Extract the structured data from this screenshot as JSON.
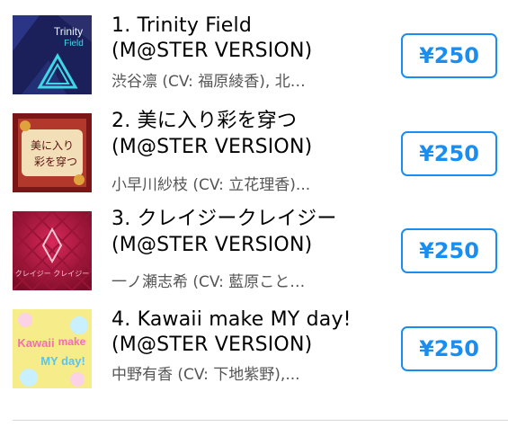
{
  "tracks": [
    {
      "title_line1": "1. Trinity Field",
      "title_line2": "(M@STER VERSION)",
      "artist": "渋谷凛 (CV: 福原綾香), 北…",
      "price": "¥250",
      "art_text": [
        "Trinity",
        "Field"
      ],
      "colors": {
        "bg": "#1b1f5a",
        "accent": "#3fd6e6"
      }
    },
    {
      "title_line1": "2. 美に入り彩を穿つ",
      "title_line2": "(M@STER VERSION)",
      "artist": "小早川紗枝 (CV: 立花理香)...",
      "price": "¥250",
      "art_text": [
        "美に入り",
        "彩を穿つ"
      ],
      "colors": {
        "bg": "#8c1b1b",
        "accent": "#f3dfb7"
      }
    },
    {
      "title_line1": "3. クレイジークレイジー",
      "title_line2": "(M@STER VERSION)",
      "artist": "一ノ瀬志希 (CV: 藍原こと…",
      "price": "¥250",
      "art_text": [
        "クレイジー クレイジー"
      ],
      "colors": {
        "bg": "#a3123a",
        "accent": "#f7c6d4"
      }
    },
    {
      "title_line1": "4. Kawaii make MY day!",
      "title_line2": "(M@STER VERSION)",
      "artist": "中野有香 (CV: 下地紫野),...",
      "price": "¥250",
      "art_text": [
        "Kawaii",
        "make",
        "MY day!"
      ],
      "colors": {
        "bg": "#f7ec8a",
        "accent": "#f36fb3"
      }
    }
  ],
  "accent_color": "#1a8ef0"
}
